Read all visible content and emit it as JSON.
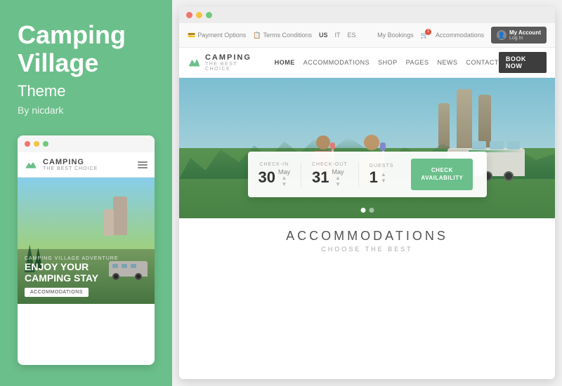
{
  "left": {
    "title_line1": "Camping",
    "title_line2": "Village",
    "subtitle": "Theme",
    "author": "By nicdark",
    "dots": [
      "red",
      "yellow",
      "green"
    ],
    "mockup": {
      "logo_text": "CAMPING",
      "logo_subtext": "THE BEST CHOICE",
      "hero_small": "CAMPING VILLAGE ADVENTURE",
      "hero_title_line1": "ENJOY YOUR",
      "hero_title_line2": "CAMPING STAY",
      "hero_btn": "ACCOMMODATIONS"
    }
  },
  "browser": {
    "dots": [
      "red",
      "yellow",
      "green"
    ],
    "utility": {
      "payment_options": "Payment Options",
      "terms_conditions": "Terms Conditions",
      "langs": [
        "US",
        "IT",
        "ES"
      ],
      "active_lang": "US",
      "my_bookings": "My Bookings",
      "accommodations": "Accommodations",
      "account_label": "My Account",
      "account_sub": "Log In",
      "cart_badge": "1"
    },
    "nav": {
      "logo_text": "CAMPING",
      "logo_sub": "THE BEST CHOICE",
      "items": [
        "HOME",
        "ACCOMMODATIONS",
        "SHOP",
        "PAGES",
        "NEWS",
        "CONTACT"
      ],
      "book_btn": "BOOK NOW"
    },
    "hero": {
      "carousel_dots": [
        true,
        false
      ]
    },
    "booking": {
      "checkin_label": "CHECK-IN",
      "checkin_day": "30",
      "checkin_month": "May",
      "checkout_label": "CHECK-OUT",
      "checkout_day": "31",
      "checkout_month": "May",
      "guests_label": "GUESTS",
      "guests_value": "1",
      "check_btn_line1": "CHECK",
      "check_btn_line2": "AVAILABILITY"
    },
    "accommodations": {
      "title": "ACCOMMODATIONS",
      "subtitle": "CHOOSE THE BEST"
    }
  }
}
